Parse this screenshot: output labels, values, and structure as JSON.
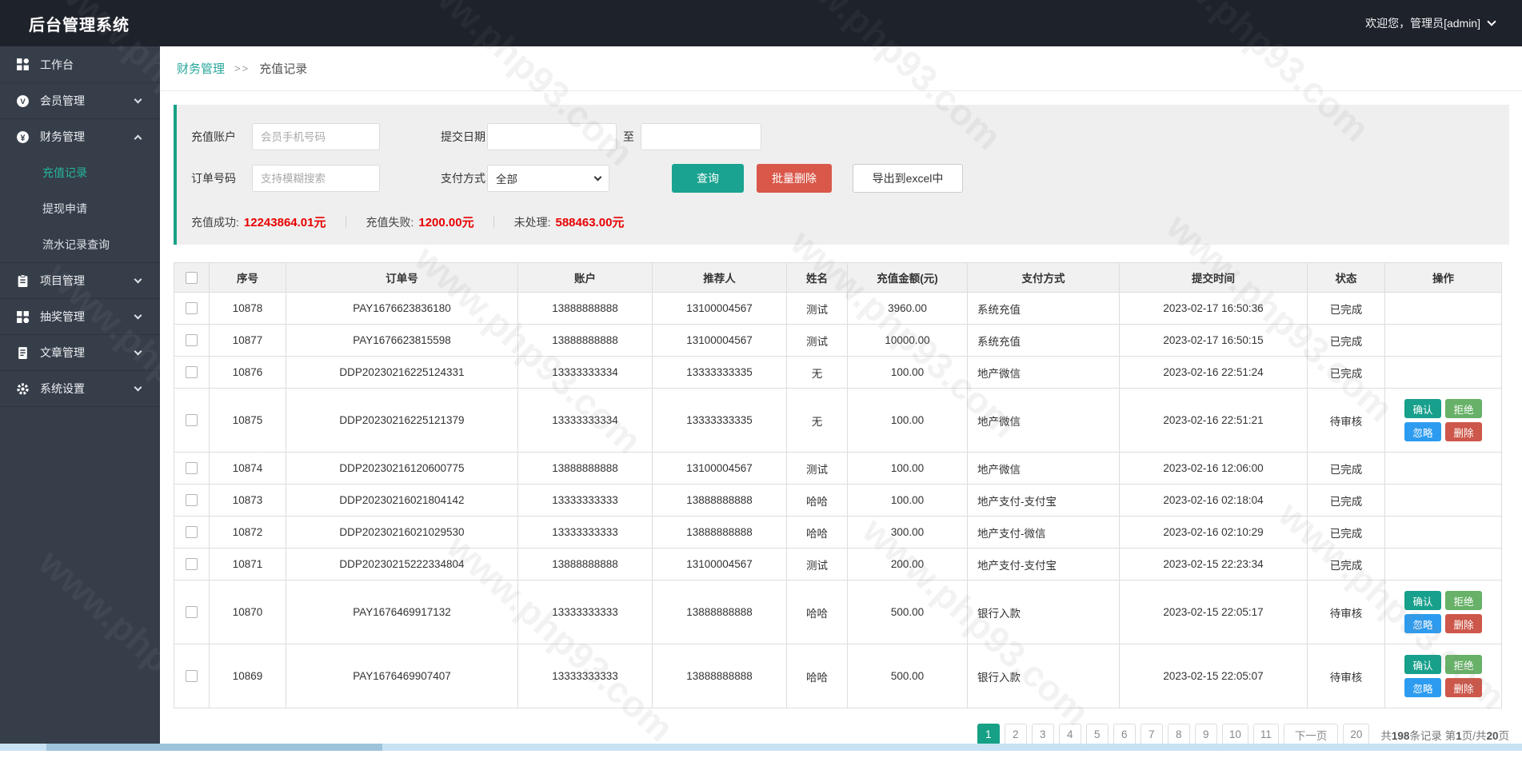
{
  "colors": {
    "accent_teal": "#16a085",
    "topbar_bg": "#1e222a",
    "sidebar_bg": "#363e4a",
    "danger_red": "#d9584a",
    "stat_red": "#e80000",
    "action_confirm": "#17a08b",
    "action_reject": "#67b168",
    "action_ignore": "#2d9cf0",
    "action_delete": "#cd574a"
  },
  "watermark": "www.php93.com",
  "topbar": {
    "title": "后台管理系统",
    "user": "欢迎您，管理员[admin]"
  },
  "sidebar": {
    "items": [
      {
        "icon": "dashboard-icon",
        "label": "工作台"
      },
      {
        "icon": "member-icon",
        "label": "会员管理",
        "chevron": "down"
      },
      {
        "icon": "finance-icon",
        "label": "财务管理",
        "chevron": "up",
        "children": [
          {
            "label": "充值记录",
            "active": true
          },
          {
            "label": "提现申请",
            "active": false
          },
          {
            "label": "流水记录查询",
            "active": false
          }
        ]
      },
      {
        "icon": "project-icon",
        "label": "项目管理",
        "chevron": "down"
      },
      {
        "icon": "lottery-icon",
        "label": "抽奖管理",
        "chevron": "down"
      },
      {
        "icon": "article-icon",
        "label": "文章管理",
        "chevron": "down"
      },
      {
        "icon": "settings-icon",
        "label": "系统设置",
        "chevron": "down"
      }
    ]
  },
  "breadcrumb": {
    "parent": "财务管理",
    "separator": ">>",
    "current": "充值记录"
  },
  "filters": {
    "account_label": "充值账户",
    "account_placeholder": "会员手机号码",
    "date_label": "提交日期",
    "date_to": "至",
    "order_label": "订单号码",
    "order_placeholder": "支持模糊搜索",
    "pay_label": "支付方式",
    "pay_selected": "全部",
    "search_btn": "查询",
    "batch_delete_btn": "批量删除",
    "export_btn": "导出到excel中"
  },
  "stats": {
    "s0_label": "充值成功:",
    "s0_value": "12243864.01元",
    "s1_label": "充值失败:",
    "s1_value": "1200.00元",
    "s2_label": "未处理:",
    "s2_value": "588463.00元",
    "separator": "｜"
  },
  "table": {
    "headers": [
      "序号",
      "订单号",
      "账户",
      "推荐人",
      "姓名",
      "充值金额(元)",
      "支付方式",
      "提交时间",
      "状态",
      "操作"
    ],
    "rows": [
      {
        "id": "10878",
        "order_no": "PAY1676623836180",
        "account": "13888888888",
        "referrer": "13100004567",
        "name": "测试",
        "amount": "3960.00",
        "pay": "系统充值",
        "time": "2023-02-17 16:50:36",
        "status": "已完成",
        "actions": []
      },
      {
        "id": "10877",
        "order_no": "PAY1676623815598",
        "account": "13888888888",
        "referrer": "13100004567",
        "name": "测试",
        "amount": "10000.00",
        "pay": "系统充值",
        "time": "2023-02-17 16:50:15",
        "status": "已完成",
        "actions": []
      },
      {
        "id": "10876",
        "order_no": "DDP20230216225124331",
        "account": "13333333334",
        "referrer": "13333333335",
        "name": "无",
        "amount": "100.00",
        "pay": "地产微信",
        "time": "2023-02-16 22:51:24",
        "status": "已完成",
        "actions": []
      },
      {
        "id": "10875",
        "order_no": "DDP20230216225121379",
        "account": "13333333334",
        "referrer": "13333333335",
        "name": "无",
        "amount": "100.00",
        "pay": "地产微信",
        "time": "2023-02-16 22:51:21",
        "status": "待审核",
        "actions": [
          "确认",
          "拒绝",
          "忽略",
          "删除"
        ]
      },
      {
        "id": "10874",
        "order_no": "DDP20230216120600775",
        "account": "13888888888",
        "referrer": "13100004567",
        "name": "测试",
        "amount": "100.00",
        "pay": "地产微信",
        "time": "2023-02-16 12:06:00",
        "status": "已完成",
        "actions": []
      },
      {
        "id": "10873",
        "order_no": "DDP20230216021804142",
        "account": "13333333333",
        "referrer": "13888888888",
        "name": "哈哈",
        "amount": "100.00",
        "pay": "地产支付-支付宝",
        "time": "2023-02-16 02:18:04",
        "status": "已完成",
        "actions": []
      },
      {
        "id": "10872",
        "order_no": "DDP20230216021029530",
        "account": "13333333333",
        "referrer": "13888888888",
        "name": "哈哈",
        "amount": "300.00",
        "pay": "地产支付-微信",
        "time": "2023-02-16 02:10:29",
        "status": "已完成",
        "actions": []
      },
      {
        "id": "10871",
        "order_no": "DDP20230215222334804",
        "account": "13888888888",
        "referrer": "13100004567",
        "name": "测试",
        "amount": "200.00",
        "pay": "地产支付-支付宝",
        "time": "2023-02-15 22:23:34",
        "status": "已完成",
        "actions": []
      },
      {
        "id": "10870",
        "order_no": "PAY1676469917132",
        "account": "13333333333",
        "referrer": "13888888888",
        "name": "哈哈",
        "amount": "500.00",
        "pay": "银行入款",
        "time": "2023-02-15 22:05:17",
        "status": "待审核",
        "actions": [
          "确认",
          "拒绝",
          "忽略",
          "删除"
        ]
      },
      {
        "id": "10869",
        "order_no": "PAY1676469907407",
        "account": "13333333333",
        "referrer": "13888888888",
        "name": "哈哈",
        "amount": "500.00",
        "pay": "银行入款",
        "time": "2023-02-15 22:05:07",
        "status": "待审核",
        "actions": [
          "确认",
          "拒绝",
          "忽略",
          "删除"
        ]
      }
    ]
  },
  "pagination": {
    "pages": [
      "1",
      "2",
      "3",
      "4",
      "5",
      "6",
      "7",
      "8",
      "9",
      "10",
      "11"
    ],
    "active": "1",
    "next": "下一页",
    "last": "20",
    "summary": {
      "pre": "共",
      "total": "198",
      "mid": "条记录 第",
      "page": "1",
      "mid2": "页/共",
      "pages": "20",
      "post": "页"
    }
  }
}
